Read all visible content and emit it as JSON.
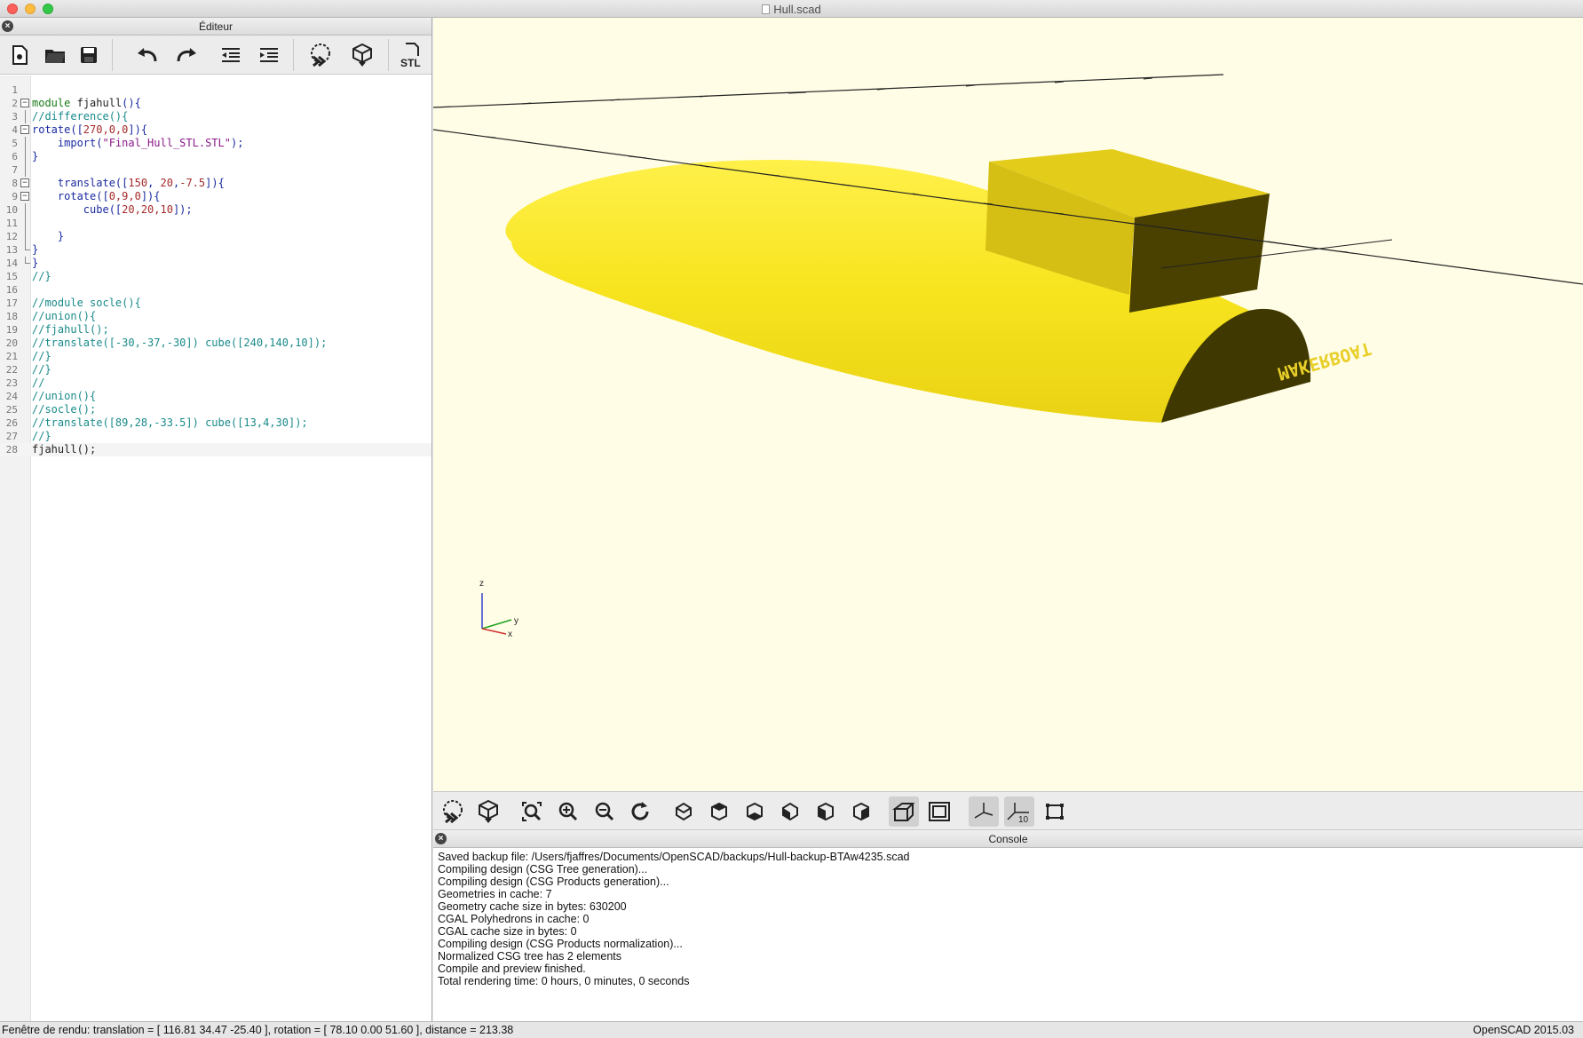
{
  "window": {
    "title": "Hull.scad"
  },
  "editor": {
    "panel_title": "Éditeur",
    "toolbar": [
      "new-file",
      "open-file",
      "save-file",
      "undo",
      "redo",
      "unindent",
      "indent",
      "preview",
      "render",
      "export-stl"
    ],
    "stl_label": "STL",
    "lines": [
      {
        "n": "1",
        "html": ""
      },
      {
        "n": "2",
        "html": "<span class='kw'>module</span> <span class='pl'>fjahull</span><span class='fn'>(){</span>"
      },
      {
        "n": "3",
        "html": "<span class='cm'>//difference(){</span>"
      },
      {
        "n": "4",
        "html": "<span class='fn'>rotate([</span><span class='num'>270,0,0</span><span class='fn'>]){</span>"
      },
      {
        "n": "5",
        "html": "    <span class='fn'>import(</span><span class='str'>\"Final_Hull_STL.STL\"</span><span class='fn'>);</span>"
      },
      {
        "n": "6",
        "html": "<span class='fn'>}</span>"
      },
      {
        "n": "7",
        "html": ""
      },
      {
        "n": "8",
        "html": "    <span class='fn'>translate([</span><span class='num'>150</span><span class='fn'>, </span><span class='num'>20</span><span class='fn'>,</span><span class='num'>-7.5</span><span class='fn'>]){</span>"
      },
      {
        "n": "9",
        "html": "    <span class='fn'>rotate([</span><span class='num'>0,9,0</span><span class='fn'>]){</span>"
      },
      {
        "n": "10",
        "html": "        <span class='fn'>cube([</span><span class='num'>20,20,10</span><span class='fn'>]);</span>"
      },
      {
        "n": "11",
        "html": ""
      },
      {
        "n": "12",
        "html": "    <span class='fn'>}</span>"
      },
      {
        "n": "13",
        "html": "<span class='fn'>}</span>"
      },
      {
        "n": "14",
        "html": "<span class='fn'>}</span>"
      },
      {
        "n": "15",
        "html": "<span class='cm'>//}</span>"
      },
      {
        "n": "16",
        "html": ""
      },
      {
        "n": "17",
        "html": "<span class='cm'>//module socle(){</span>"
      },
      {
        "n": "18",
        "html": "<span class='cm'>//union(){</span>"
      },
      {
        "n": "19",
        "html": "<span class='cm'>//fjahull();</span>"
      },
      {
        "n": "20",
        "html": "<span class='cm'>//translate([-30,-37,-30]) cube([240,140,10]);</span>"
      },
      {
        "n": "21",
        "html": "<span class='cm'>//}</span>"
      },
      {
        "n": "22",
        "html": "<span class='cm'>//}</span>"
      },
      {
        "n": "23",
        "html": "<span class='cm'>//</span>"
      },
      {
        "n": "24",
        "html": "<span class='cm'>//union(){</span>"
      },
      {
        "n": "25",
        "html": "<span class='cm'>//socle();</span>"
      },
      {
        "n": "26",
        "html": "<span class='cm'>//translate([89,28,-33.5]) cube([13,4,30]);</span>"
      },
      {
        "n": "27",
        "html": "<span class='cm'>//}</span>"
      },
      {
        "n": "28",
        "html": "<span class='pl'>fjahull();</span>"
      }
    ]
  },
  "viewport": {
    "axis_labels": {
      "x": "x",
      "y": "y",
      "z": "z"
    },
    "engraving": "MAKERBOAT",
    "colors": {
      "background": "#fffde6",
      "model": "#f5e21c",
      "model_dark": "#4a4100",
      "cube": "#d9c21a"
    }
  },
  "view_toolbar": [
    "preview",
    "render",
    "view-all",
    "zoom-in",
    "zoom-out",
    "reset-view",
    "view-right",
    "view-top",
    "view-bottom",
    "view-left",
    "view-front",
    "view-back",
    "perspective",
    "orthogonal",
    "show-axes",
    "show-scale-markers",
    "show-edges"
  ],
  "scale_label": "10",
  "console": {
    "panel_title": "Console",
    "lines": [
      "Saved backup file: /Users/fjaffres/Documents/OpenSCAD/backups/Hull-backup-BTAw4235.scad",
      "Compiling design (CSG Tree generation)...",
      "Compiling design (CSG Products generation)...",
      "Geometries in cache: 7",
      "Geometry cache size in bytes: 630200",
      "CGAL Polyhedrons in cache: 0",
      "CGAL cache size in bytes: 0",
      "Compiling design (CSG Products normalization)...",
      "Normalized CSG tree has 2 elements",
      "Compile and preview finished.",
      "Total rendering time: 0 hours, 0 minutes, 0 seconds"
    ]
  },
  "status": {
    "left": "Fenêtre de rendu: translation = [ 116.81 34.47 -25.40 ], rotation = [ 78.10 0.00 51.60 ], distance = 213.38",
    "right": "OpenSCAD 2015.03"
  }
}
